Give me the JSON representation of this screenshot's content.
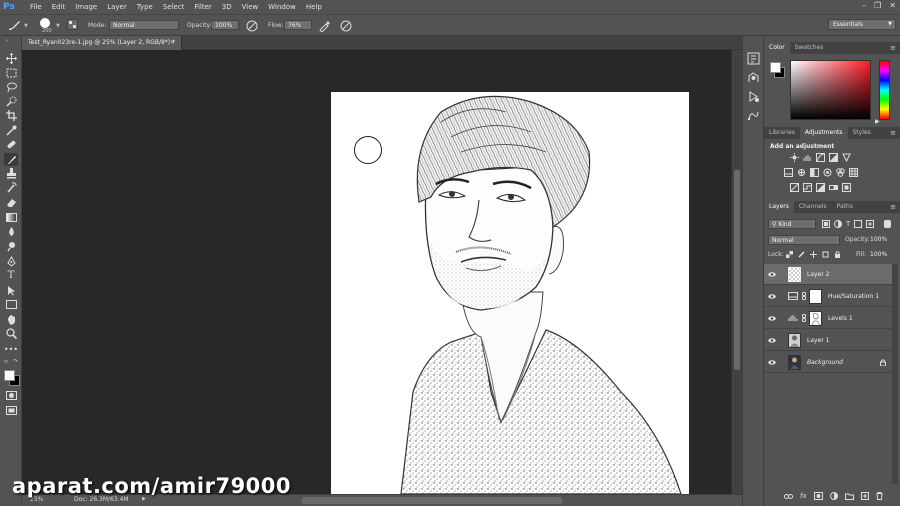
{
  "app": {
    "logo": "Ps"
  },
  "menu": [
    "File",
    "Edit",
    "Image",
    "Layer",
    "Type",
    "Select",
    "Filter",
    "3D",
    "View",
    "Window",
    "Help"
  ],
  "options": {
    "brush_size": "200",
    "mode_label": "Mode:",
    "mode_value": "Normal",
    "opacity_label": "Opacity:",
    "opacity_value": "100%",
    "flow_label": "Flow:",
    "flow_value": "76%",
    "workspace": "Essentials"
  },
  "document": {
    "tab_title": "Test_Ryan023re-1.jpg @ 25% (Layer 2, RGB/8*) *",
    "zoom": "25%",
    "doc_size": "Doc: 26.3M/63.4M"
  },
  "color_panel": {
    "tabs": [
      "Color",
      "Swatches"
    ]
  },
  "adjust_panel": {
    "tabs": [
      "Libraries",
      "Adjustments",
      "Styles"
    ],
    "heading": "Add an adjustment"
  },
  "layers_panel": {
    "tabs": [
      "Layers",
      "Channels",
      "Paths"
    ],
    "kind": "Kind",
    "blend": "Normal",
    "opacity_label": "Opacity:",
    "opacity_value": "100%",
    "lock_label": "Lock:",
    "fill_label": "Fill:",
    "fill_value": "100%",
    "layers": [
      {
        "name": "Layer 2"
      },
      {
        "name": "Hue/Saturation 1"
      },
      {
        "name": "Levels 1"
      },
      {
        "name": "Layer 1"
      },
      {
        "name": "Background"
      }
    ]
  },
  "watermark": "aparat.com/amir79000",
  "colors": {
    "accent_blue": "#4aa3ff",
    "panel_bg": "#535353",
    "canvas_bg": "#282828"
  }
}
